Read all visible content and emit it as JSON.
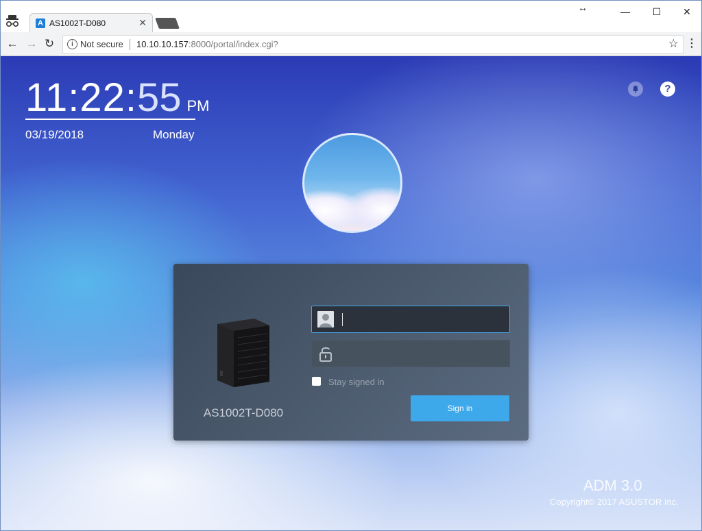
{
  "browser": {
    "tab_title": "AS1002T-D080",
    "tab_favicon_letter": "A",
    "close_glyph": "✕",
    "window_controls": {
      "minimize": "—",
      "maximize": "☐",
      "close": "✕"
    },
    "resize_glyph": "↔",
    "nav": {
      "back": "←",
      "forward": "→",
      "reload": "↻"
    },
    "security_label": "Not secure",
    "url_host": "10.10.10.157",
    "url_rest": ":8000/portal/index.cgi?",
    "bookmark_glyph": "☆",
    "menu_glyph": "⋮",
    "accent": "#1e7dd7"
  },
  "clock": {
    "hours_minutes": "11:22:",
    "seconds": "55",
    "ampm": "PM",
    "date": "03/19/2018",
    "weekday": "Monday"
  },
  "top_right": {
    "notification_icon": "bell-icon",
    "help_glyph": "?"
  },
  "login": {
    "device_name": "AS1002T-D080",
    "device_brand": "ASUSTOR",
    "username_icon": "user-icon",
    "password_icon": "lock-icon",
    "username_value": "",
    "password_value": "",
    "stay_signed_in_label": "Stay signed in",
    "sign_in_label": "Sign in",
    "button_color": "#3da8ea",
    "focus_color": "#46a6e8"
  },
  "footer": {
    "version": "ADM 3.0",
    "copyright": "Copyright© 2017 ASUSTOR Inc."
  }
}
